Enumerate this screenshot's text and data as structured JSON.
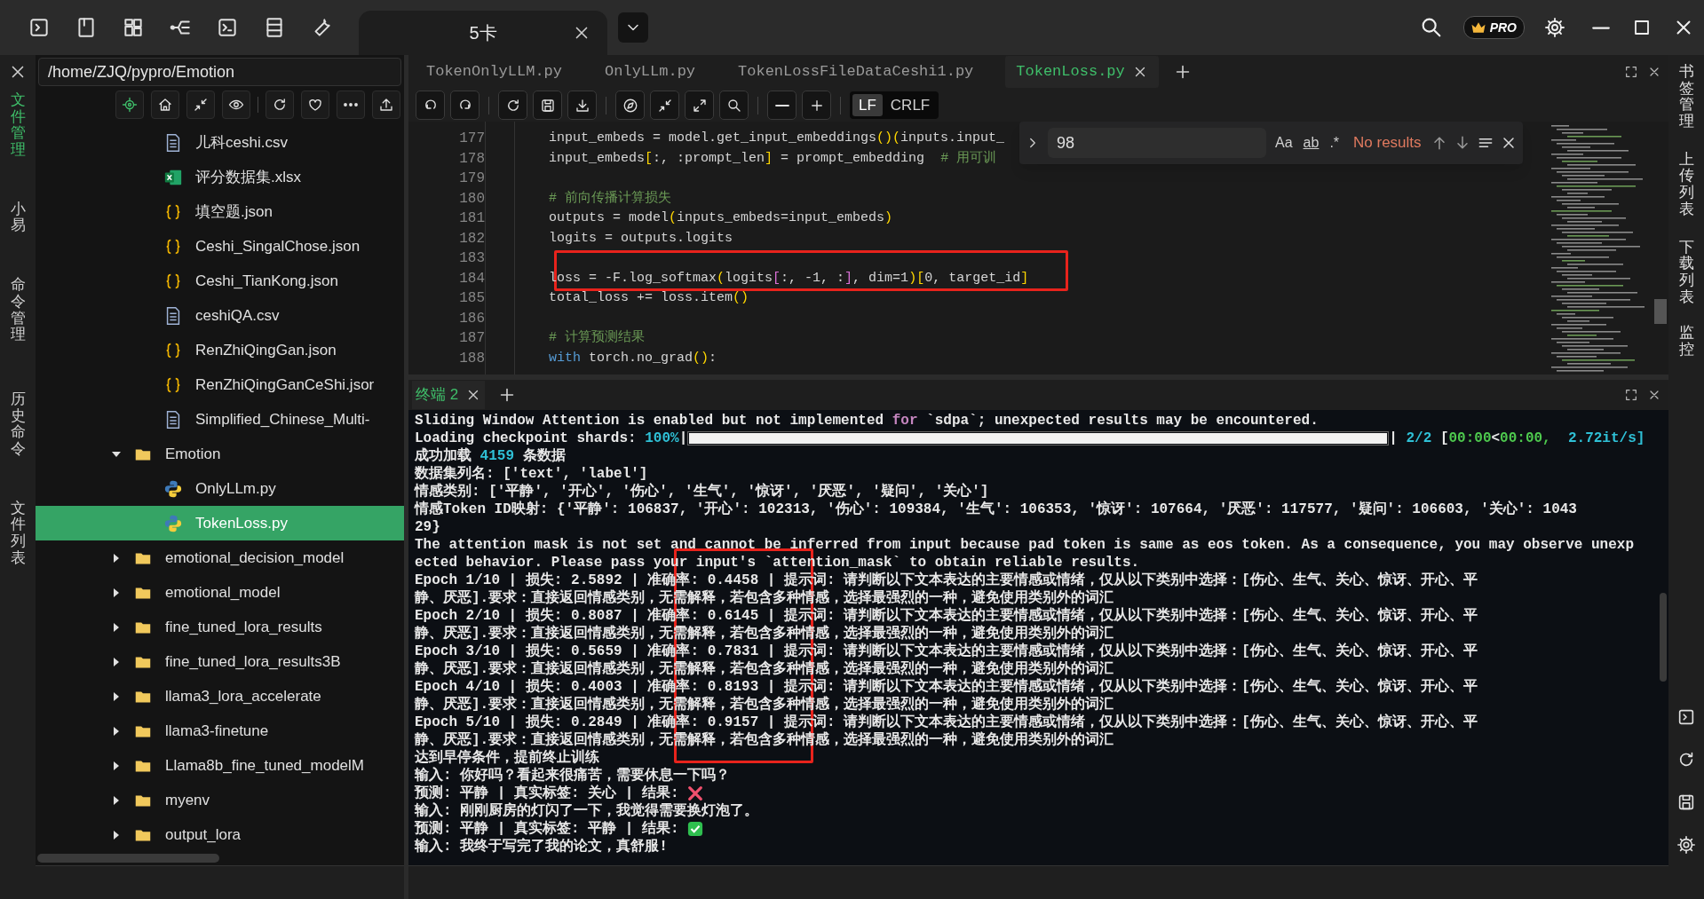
{
  "topbar": {
    "tab": {
      "label": "5卡"
    },
    "badge": "PRO"
  },
  "left_strip": {
    "items": [
      {
        "label": "文件管理",
        "selected": true
      },
      {
        "label": "小易",
        "selected": false
      },
      {
        "label": "命令管理",
        "selected": false
      },
      {
        "label": "历史命令",
        "selected": false
      },
      {
        "label": "文件列表",
        "selected": false
      }
    ]
  },
  "file_panel": {
    "path": "/home/ZJQ/pypro/Emotion",
    "tree": [
      {
        "children": [
          {
            "label": "儿科ceshi.csv",
            "kind": "document",
            "selected": false
          },
          {
            "label": "评分数据集.xlsx",
            "kind": "spreadsheet",
            "selected": false
          },
          {
            "label": "填空题.json",
            "kind": "json",
            "selected": false
          },
          {
            "label": "Ceshi_SingalChose.json",
            "kind": "json",
            "selected": false
          },
          {
            "label": "Ceshi_TianKong.json",
            "kind": "json",
            "selected": false
          },
          {
            "label": "ceshiQA.csv",
            "kind": "document",
            "selected": false
          },
          {
            "label": "RenZhiQingGan.json",
            "kind": "json",
            "selected": false
          },
          {
            "label": "RenZhiQingGanCeShi.jsor",
            "kind": "json",
            "selected": false
          },
          {
            "label": "Simplified_Chinese_Multi-",
            "kind": "document",
            "selected": false
          }
        ]
      },
      {
        "label": "Emotion",
        "kind": "folder",
        "expanded": true,
        "selected": false,
        "children": [
          {
            "label": "OnlyLLm.py",
            "kind": "python",
            "selected": false
          },
          {
            "label": "TokenLoss.py",
            "kind": "python",
            "selected": true
          }
        ]
      },
      {
        "label": "emotional_decision_model",
        "kind": "folder",
        "expanded": false,
        "selected": false
      },
      {
        "label": "emotional_model",
        "kind": "folder",
        "expanded": false,
        "selected": false
      },
      {
        "label": "fine_tuned_lora_results",
        "kind": "folder",
        "expanded": false,
        "selected": false
      },
      {
        "label": "fine_tuned_lora_results3B",
        "kind": "folder",
        "expanded": false,
        "selected": false
      },
      {
        "label": "llama3_lora_accelerate",
        "kind": "folder",
        "expanded": false,
        "selected": false
      },
      {
        "label": "llama3-finetune",
        "kind": "folder",
        "expanded": false,
        "selected": false
      },
      {
        "label": "Llama8b_fine_tuned_modelM",
        "kind": "folder",
        "expanded": false,
        "selected": false
      },
      {
        "label": "myenv",
        "kind": "folder",
        "expanded": false,
        "selected": false
      },
      {
        "label": "output_lora",
        "kind": "folder",
        "expanded": false,
        "selected": false
      }
    ]
  },
  "editor": {
    "tabs": [
      {
        "label": "TokenOnlyLLM.py",
        "selected": false
      },
      {
        "label": "OnlyLLm.py",
        "selected": false
      },
      {
        "label": "TokenLossFileDataCeshi1.py",
        "selected": false
      },
      {
        "label": "TokenLoss.py",
        "selected": true
      }
    ],
    "line_endings": [
      {
        "label": "LF",
        "selected": true
      },
      {
        "label": "CRLF",
        "selected": false
      }
    ],
    "lines": [
      {
        "number": "177",
        "segments": [
          {
            "text": "input_embeds = model.get_input_embeddings",
            "kind": "plain"
          },
          {
            "text": "()(",
            "kind": "bracket"
          },
          {
            "text": "inputs.input_",
            "kind": "plain"
          }
        ]
      },
      {
        "number": "178",
        "segments": [
          {
            "text": "input_embeds",
            "kind": "plain"
          },
          {
            "text": "[",
            "kind": "bracket"
          },
          {
            "text": ":, :prompt_len",
            "kind": "plain"
          },
          {
            "text": "]",
            "kind": "bracket"
          },
          {
            "text": " = prompt_embedding  ",
            "kind": "plain"
          },
          {
            "text": "# 用可训",
            "kind": "comment"
          }
        ]
      },
      {
        "number": "179"
      },
      {
        "number": "180",
        "segments": [
          {
            "text": "# 前向传播计算损失",
            "kind": "comment"
          }
        ]
      },
      {
        "number": "181",
        "segments": [
          {
            "text": "outputs = model",
            "kind": "plain"
          },
          {
            "text": "(",
            "kind": "bracket"
          },
          {
            "text": "inputs_embeds=input_embeds",
            "kind": "plain"
          },
          {
            "text": ")",
            "kind": "bracket"
          }
        ]
      },
      {
        "number": "182",
        "segments": [
          {
            "text": "logits = outputs.logits",
            "kind": "plain"
          }
        ]
      },
      {
        "number": "183"
      },
      {
        "number": "184",
        "segments": [
          {
            "text": "loss = -F.log_softmax",
            "kind": "plain"
          },
          {
            "text": "(",
            "kind": "bracket"
          },
          {
            "text": "logits",
            "kind": "plain"
          },
          {
            "text": "[",
            "kind": "inner_bracket"
          },
          {
            "text": ":, -1, :",
            "kind": "plain"
          },
          {
            "text": "]",
            "kind": "inner_bracket"
          },
          {
            "text": ", dim=1",
            "kind": "plain"
          },
          {
            "text": ")[",
            "kind": "bracket"
          },
          {
            "text": "0, target_id",
            "kind": "plain"
          },
          {
            "text": "]",
            "kind": "bracket"
          }
        ]
      },
      {
        "number": "185",
        "segments": [
          {
            "text": "total_loss += loss.item",
            "kind": "plain"
          },
          {
            "text": "()",
            "kind": "bracket"
          }
        ]
      },
      {
        "number": "186"
      },
      {
        "number": "187",
        "segments": [
          {
            "text": "# 计算预测结果",
            "kind": "comment"
          }
        ]
      },
      {
        "number": "188",
        "segments": [
          {
            "text": "with",
            "kind": "keyword"
          },
          {
            "text": " torch.no_grad",
            "kind": "plain"
          },
          {
            "text": "()",
            "kind": "bracket"
          },
          {
            "text": ":",
            "kind": "plain"
          }
        ]
      }
    ],
    "find": {
      "value": "98",
      "options": [
        "Aa",
        "ab",
        ".*"
      ],
      "status": "No results"
    }
  },
  "terminal": {
    "tabs": [
      {
        "label": "终端 2",
        "selected": true
      }
    ],
    "lines": [
      {
        "kind": "text",
        "segments": [
          {
            "text": "Sliding Window Attention is enabled but not implemented ",
            "kind": "plain"
          },
          {
            "text": "for",
            "kind": "keyword"
          },
          {
            "text": " `sdpa`; unexpected results may be encountered.",
            "kind": "plain"
          }
        ]
      },
      {
        "kind": "progress",
        "segments": [
          {
            "text": "Loading checkpoint shards: ",
            "kind": "plain"
          },
          {
            "text": "100%",
            "kind": "number"
          },
          {
            "text": "|",
            "kind": "plain"
          }
        ],
        "level": 1,
        "after": [
          {
            "text": "| ",
            "kind": "plain"
          },
          {
            "text": "2/2",
            "kind": "number"
          },
          {
            "text": " [",
            "kind": "plain"
          },
          {
            "text": "00:00",
            "kind": "time"
          },
          {
            "text": "<",
            "kind": "plain"
          },
          {
            "text": "00:00,",
            "kind": "time"
          },
          {
            "text": "  2.72it/s]",
            "kind": "number"
          }
        ]
      },
      {
        "kind": "text",
        "segments": [
          {
            "text": "成功加载 ",
            "kind": "plain"
          },
          {
            "text": "4159",
            "kind": "number"
          },
          {
            "text": " 条数据",
            "kind": "plain"
          }
        ]
      },
      {
        "kind": "text",
        "segments": [
          {
            "text": "数据集列名: ['text', 'label']",
            "kind": "plain"
          }
        ]
      },
      {
        "kind": "text",
        "segments": [
          {
            "text": "情感类别: ['平静', '开心', '伤心', '生气', '惊讶', '厌恶', '疑问', '关心']",
            "kind": "plain"
          }
        ]
      },
      {
        "kind": "text",
        "segments": [
          {
            "text": "情感Token ID映射: {'平静': 106837, '开心': 102313, '伤心': 109384, '生气': 106353, '惊讶': 107664, '厌恶': 117577, '疑问': 106603, '关心': 1043",
            "kind": "plain"
          }
        ]
      },
      {
        "kind": "text",
        "segments": [
          {
            "text": "29}",
            "kind": "plain"
          }
        ]
      },
      {
        "kind": "text",
        "segments": [
          {
            "text": "The attention mask is not set and cannot be inferred from input because pad token is same as eos token. As a consequence, you may observe unexp",
            "kind": "plain"
          }
        ]
      },
      {
        "kind": "text",
        "segments": [
          {
            "text": "ected behavior. Please pass your input's `attention_mask` to obtain reliable results.",
            "kind": "plain"
          }
        ]
      },
      {
        "kind": "text",
        "segments": [
          {
            "text": "Epoch 1/10 | 损失: 2.5892 | 准确率: 0.4458 | 提示词: 请判断以下文本表达的主要情感或情绪，仅从以下类别中选择：[伤心、生气、关心、惊讶、开心、平",
            "kind": "plain"
          }
        ]
      },
      {
        "kind": "text",
        "segments": [
          {
            "text": "静、厌恶].要求：直接返回情感类别，无需解释，若包含多种情感，选择最强烈的一种，避免使用类别外的词汇",
            "kind": "plain"
          }
        ]
      },
      {
        "kind": "text",
        "segments": [
          {
            "text": "Epoch 2/10 | 损失: 0.8087 | 准确率: 0.6145 | 提示词: 请判断以下文本表达的主要情感或情绪，仅从以下类别中选择：[伤心、生气、关心、惊讶、开心、平",
            "kind": "plain"
          }
        ]
      },
      {
        "kind": "text",
        "segments": [
          {
            "text": "静、厌恶].要求：直接返回情感类别，无需解释，若包含多种情感，选择最强烈的一种，避免使用类别外的词汇",
            "kind": "plain"
          }
        ]
      },
      {
        "kind": "text",
        "segments": [
          {
            "text": "Epoch 3/10 | 损失: 0.5659 | 准确率: 0.7831 | 提示词: 请判断以下文本表达的主要情感或情绪，仅从以下类别中选择：[伤心、生气、关心、惊讶、开心、平",
            "kind": "plain"
          }
        ]
      },
      {
        "kind": "text",
        "segments": [
          {
            "text": "静、厌恶].要求：直接返回情感类别，无需解释，若包含多种情感，选择最强烈的一种，避免使用类别外的词汇",
            "kind": "plain"
          }
        ]
      },
      {
        "kind": "text",
        "segments": [
          {
            "text": "Epoch 4/10 | 损失: 0.4003 | 准确率: 0.8193 | 提示词: 请判断以下文本表达的主要情感或情绪，仅从以下类别中选择：[伤心、生气、关心、惊讶、开心、平",
            "kind": "plain"
          }
        ]
      },
      {
        "kind": "text",
        "segments": [
          {
            "text": "静、厌恶].要求：直接返回情感类别，无需解释，若包含多种情感，选择最强烈的一种，避免使用类别外的词汇",
            "kind": "plain"
          }
        ]
      },
      {
        "kind": "text",
        "segments": [
          {
            "text": "Epoch 5/10 | 损失: 0.2849 | 准确率: 0.9157 | 提示词: 请判断以下文本表达的主要情感或情绪，仅从以下类别中选择：[伤心、生气、关心、惊讶、开心、平",
            "kind": "plain"
          }
        ]
      },
      {
        "kind": "text",
        "segments": [
          {
            "text": "静、厌恶].要求：直接返回情感类别，无需解释，若包含多种情感，选择最强烈的一种，避免使用类别外的词汇",
            "kind": "plain"
          }
        ]
      },
      {
        "kind": "text",
        "segments": [
          {
            "text": "达到早停条件，提前终止训练",
            "kind": "plain"
          }
        ]
      },
      {
        "kind": "text",
        "segments": [
          {
            "text": "输入: 你好吗？看起来很痛苦，需要休息一下吗？",
            "kind": "plain"
          }
        ]
      },
      {
        "kind": "result",
        "segments": [
          {
            "text": "预测: 平静 | 真实标签: 关心 | 结果: ",
            "kind": "plain"
          }
        ],
        "correct": false
      },
      {
        "kind": "text",
        "segments": [
          {
            "text": "输入: 刚刚厨房的灯闪了一下，我觉得需要换灯泡了。",
            "kind": "plain"
          }
        ]
      },
      {
        "kind": "result",
        "segments": [
          {
            "text": "预测: 平静 | 真实标签: 平静 | 结果: ",
            "kind": "plain"
          }
        ],
        "correct": true
      },
      {
        "kind": "text",
        "segments": [
          {
            "text": "输入: 我终于写完了我的论文，真舒服!",
            "kind": "plain"
          }
        ]
      }
    ]
  },
  "right_strip": {
    "items": [
      "书签管理",
      "上传列表",
      "下载列表",
      "监控"
    ]
  }
}
